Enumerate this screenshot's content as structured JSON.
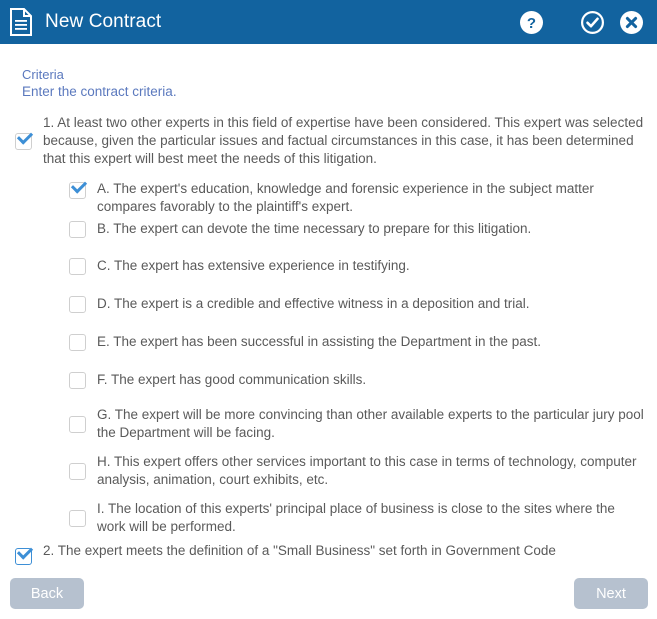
{
  "window": {
    "title": "New Contract",
    "doc_icon": "document-icon",
    "help_icon": "help-circle-icon",
    "confirm_icon": "check-circle-icon",
    "close_icon": "close-circle-icon",
    "header_color": "#12639F"
  },
  "section": {
    "title": "Criteria",
    "subtitle": "Enter the contract criteria.",
    "link_color": "#5B79BE"
  },
  "questions": [
    {
      "id": "1",
      "checked": true,
      "text": "1. At least two other experts in this field of expertise have been considered. This expert was selected because, given the particular\nissues and factual circumstances in this case, it has been determined that this expert will best meet the needs of this litigation."
    },
    {
      "id": "A",
      "checked": true,
      "text": "A. The expert's education, knowledge and forensic experience in the subject matter compares favorably to the plaintiff's expert."
    },
    {
      "id": "B",
      "checked": false,
      "text": "B. The expert can devote the time necessary to prepare for this litigation."
    },
    {
      "id": "C",
      "checked": false,
      "text": "C. The expert has extensive experience in testifying."
    },
    {
      "id": "D",
      "checked": false,
      "text": "D. The expert is a credible and effective witness in a deposition and trial."
    },
    {
      "id": "E",
      "checked": false,
      "text": "E. The expert has been successful in assisting the Department in the past."
    },
    {
      "id": "F",
      "checked": false,
      "text": "F. The expert has good communication skills."
    },
    {
      "id": "G",
      "checked": false,
      "text": "G. The expert will be more convincing than other available experts to the particular jury pool the Department will be facing."
    },
    {
      "id": "H",
      "checked": false,
      "text": "H. This expert offers other services important to this case in terms of technology, computer analysis, animation, court exhibits, etc."
    },
    {
      "id": "I",
      "checked": false,
      "text": "I. The location of this experts' principal place of business is close to the sites where the work will be performed."
    }
  ],
  "clipped_question": {
    "id": "2",
    "checked": true,
    "text": "2. The expert meets the definition of a \"Small Business\" set forth in Government Code"
  },
  "footer": {
    "back_label": "Back",
    "next_label": "Next",
    "button_color": "#B6C1CF"
  }
}
